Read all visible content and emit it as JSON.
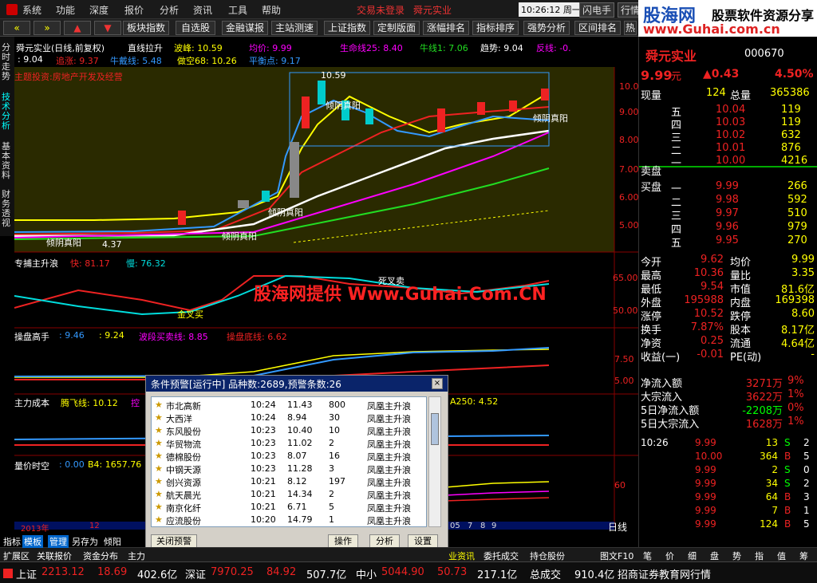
{
  "menu": [
    "系统",
    "功能",
    "深度",
    "报价",
    "分析",
    "资讯",
    "工具",
    "帮助"
  ],
  "login_text": "交易未登录",
  "stock_title": "舜元实业",
  "clock": "10:26:12 周一",
  "top_right_btns": [
    "闪电手",
    "行情"
  ],
  "banner": {
    "logo": "股海网",
    "slogan": "股票软件资源分享",
    "url": "www.Guhai.com.cn"
  },
  "toolbar": [
    "板块指数",
    "自选股",
    "金融谋报",
    "主站测速",
    "上证指数",
    "定制版面",
    "涨幅排名",
    "指标排序",
    "强势分析",
    "区间排名",
    "热"
  ],
  "chart": {
    "header": "舜元实业(日线,前复权)",
    "header_items": [
      "直线拉升",
      "波峰: 10.59",
      "均价: 9.99",
      "生命线25: 8.40",
      "牛线1: 7.06",
      "趋势: 9.04",
      "反线: -0."
    ],
    "header2": [
      ": 9.04",
      "追涨: 9.37",
      "牛戴线: 5.48",
      "做空68: 10.26",
      "平衡点: 9.17"
    ],
    "theme": "主题投资:房地产开发及经营",
    "price_ticks": [
      "10.00",
      "9.00",
      "8.00",
      "7.00",
      "6.00",
      "5.00"
    ],
    "annotations": [
      "10.59",
      "4.37",
      "倾阴真阳",
      "倾阴真阳",
      "倾阴真阳",
      "倾阴真阳",
      "倾阴真阳"
    ],
    "sub1_header": [
      "专捕主升浪",
      "快: 81.17",
      "慢: 76.32"
    ],
    "sub1_ticks": [
      "65.00",
      "50.00"
    ],
    "sub1_labels": [
      "死叉卖",
      "金叉买"
    ],
    "watermark": "股海网提供 Www.Guhai.Com.CN",
    "sub2_header": [
      "操盘高手",
      ": 9.46",
      ": 9.24",
      "波段买卖线: 8.85",
      "操盘底线: 6.62"
    ],
    "sub2_ticks": [
      "7.50",
      "5.00"
    ],
    "sub3_header": [
      "主力成本",
      "腾飞线: 10.12",
      "控",
      "A250: 4.52"
    ],
    "sub4_header": [
      "量价时空",
      ": 0.00",
      "B4: 1657.76"
    ],
    "sub4_ticks": [
      "60"
    ],
    "year_label": "2013年",
    "month_label": "12",
    "date_nums": [
      "05",
      "7",
      "8",
      "9"
    ],
    "period": "日线"
  },
  "quote": {
    "code_name": "舜元实业",
    "code": "000670",
    "price": "9.99",
    "unit": "元",
    "change": "▲0.43",
    "pct": "4.50%",
    "now_label": "现量",
    "now_vol": "124",
    "total_label": "总量",
    "total_vol": "365386",
    "sells": [
      {
        "lvl": "五",
        "price": "10.04",
        "vol": "119"
      },
      {
        "lvl": "四",
        "price": "10.03",
        "vol": "119"
      },
      {
        "lvl": "三",
        "price": "10.02",
        "vol": "632"
      },
      {
        "lvl": "二",
        "price": "10.01",
        "vol": "876"
      },
      {
        "lvl": "一",
        "price": "10.00",
        "vol": "4216"
      }
    ],
    "sell_label": "卖盘",
    "buy_label": "买盘",
    "buys": [
      {
        "lvl": "一",
        "price": "9.99",
        "vol": "266"
      },
      {
        "lvl": "二",
        "price": "9.98",
        "vol": "592"
      },
      {
        "lvl": "三",
        "price": "9.97",
        "vol": "510"
      },
      {
        "lvl": "四",
        "price": "9.96",
        "vol": "979"
      },
      {
        "lvl": "五",
        "price": "9.95",
        "vol": "270"
      }
    ],
    "stats": [
      [
        "今开",
        "9.62",
        "均价",
        "9.99"
      ],
      [
        "最高",
        "10.36",
        "量比",
        "3.35"
      ],
      [
        "最低",
        "9.54",
        "市值",
        "81.6亿"
      ],
      [
        "外盘",
        "195988",
        "内盘",
        "169398"
      ],
      [
        "涨停",
        "10.52",
        "跌停",
        "8.60"
      ],
      [
        "换手",
        "7.87%",
        "股本",
        "8.17亿"
      ],
      [
        "净资",
        "0.25",
        "流通",
        "4.64亿"
      ],
      [
        "收益(一)",
        "-0.01",
        "PE(动)",
        "-"
      ]
    ],
    "flows": [
      [
        "净流入额",
        "3271万",
        "9%"
      ],
      [
        "大宗流入",
        "3622万",
        "1%"
      ],
      [
        "5日净流入额",
        "-2208万",
        "0%"
      ],
      [
        "5日大宗流入",
        "1628万",
        "1%"
      ]
    ],
    "ticks": [
      [
        "10:26",
        "9.99",
        "13",
        "S",
        "2"
      ],
      [
        "",
        "10.00",
        "364",
        "B",
        "5"
      ],
      [
        "",
        "9.99",
        "2",
        "S",
        "0"
      ],
      [
        "",
        "9.99",
        "34",
        "S",
        "2"
      ],
      [
        "",
        "9.99",
        "64",
        "B",
        "3"
      ],
      [
        "",
        "9.99",
        "7",
        "B",
        "1"
      ],
      [
        "",
        "9.99",
        "124",
        "B",
        "5"
      ]
    ],
    "bottom_tabs": [
      "笔",
      "价",
      "细",
      "盘",
      "势",
      "指",
      "值",
      "筹"
    ]
  },
  "dialog": {
    "title": "条件预警[运行中] 品种数:2689,预警条数:26",
    "rows": [
      [
        "市北高新",
        "10:24",
        "11.43",
        "800",
        "凤凰主升浪"
      ],
      [
        "大西洋",
        "10:24",
        "8.94",
        "30",
        "凤凰主升浪"
      ],
      [
        "东风股份",
        "10:23",
        "10.40",
        "10",
        "凤凰主升浪"
      ],
      [
        "华贸物流",
        "10:23",
        "11.02",
        "2",
        "凤凰主升浪"
      ],
      [
        "德棉股份",
        "10:23",
        "8.07",
        "16",
        "凤凰主升浪"
      ],
      [
        "中钢天源",
        "10:23",
        "11.28",
        "3",
        "凤凰主升浪"
      ],
      [
        "创兴资源",
        "10:21",
        "8.12",
        "197",
        "凤凰主升浪"
      ],
      [
        "航天晨光",
        "10:21",
        "14.34",
        "2",
        "凤凰主升浪"
      ],
      [
        "南京化纤",
        "10:21",
        "6.71",
        "5",
        "凤凰主升浪"
      ],
      [
        "应流股份",
        "10:20",
        "14.79",
        "1",
        "凤凰主升浪"
      ]
    ],
    "buttons": [
      "关闭预警",
      "操作",
      "分析",
      "设置"
    ]
  },
  "left_tabs": [
    "分时走势",
    "技术分析",
    "基本资料",
    "财务透视"
  ],
  "bottom_bar": [
    "指标",
    "模板",
    "管理",
    "另存为",
    "倾阳"
  ],
  "bottom_tabs2": [
    "扩展区",
    "关联报价",
    "资金分布",
    "主力"
  ],
  "bottom_tabs_right": [
    "业资讯",
    "委托成交",
    "持仓股份",
    "图文F10"
  ],
  "status": {
    "sh_label": "上证",
    "sh_val": "2213.12",
    "sh_chg": "18.69",
    "sh_amt": "402.6亿",
    "sz_label": "深证",
    "sz_val": "7970.25",
    "sz_chg": "84.92",
    "sz_amt": "507.7亿",
    "zx_label": "中小",
    "zx_val": "5044.90",
    "zx_chg": "50.73",
    "zx_amt": "217.1亿",
    "total_label": "总成交",
    "total_val": "910.4亿",
    "broker": "招商证券教育网行情"
  }
}
